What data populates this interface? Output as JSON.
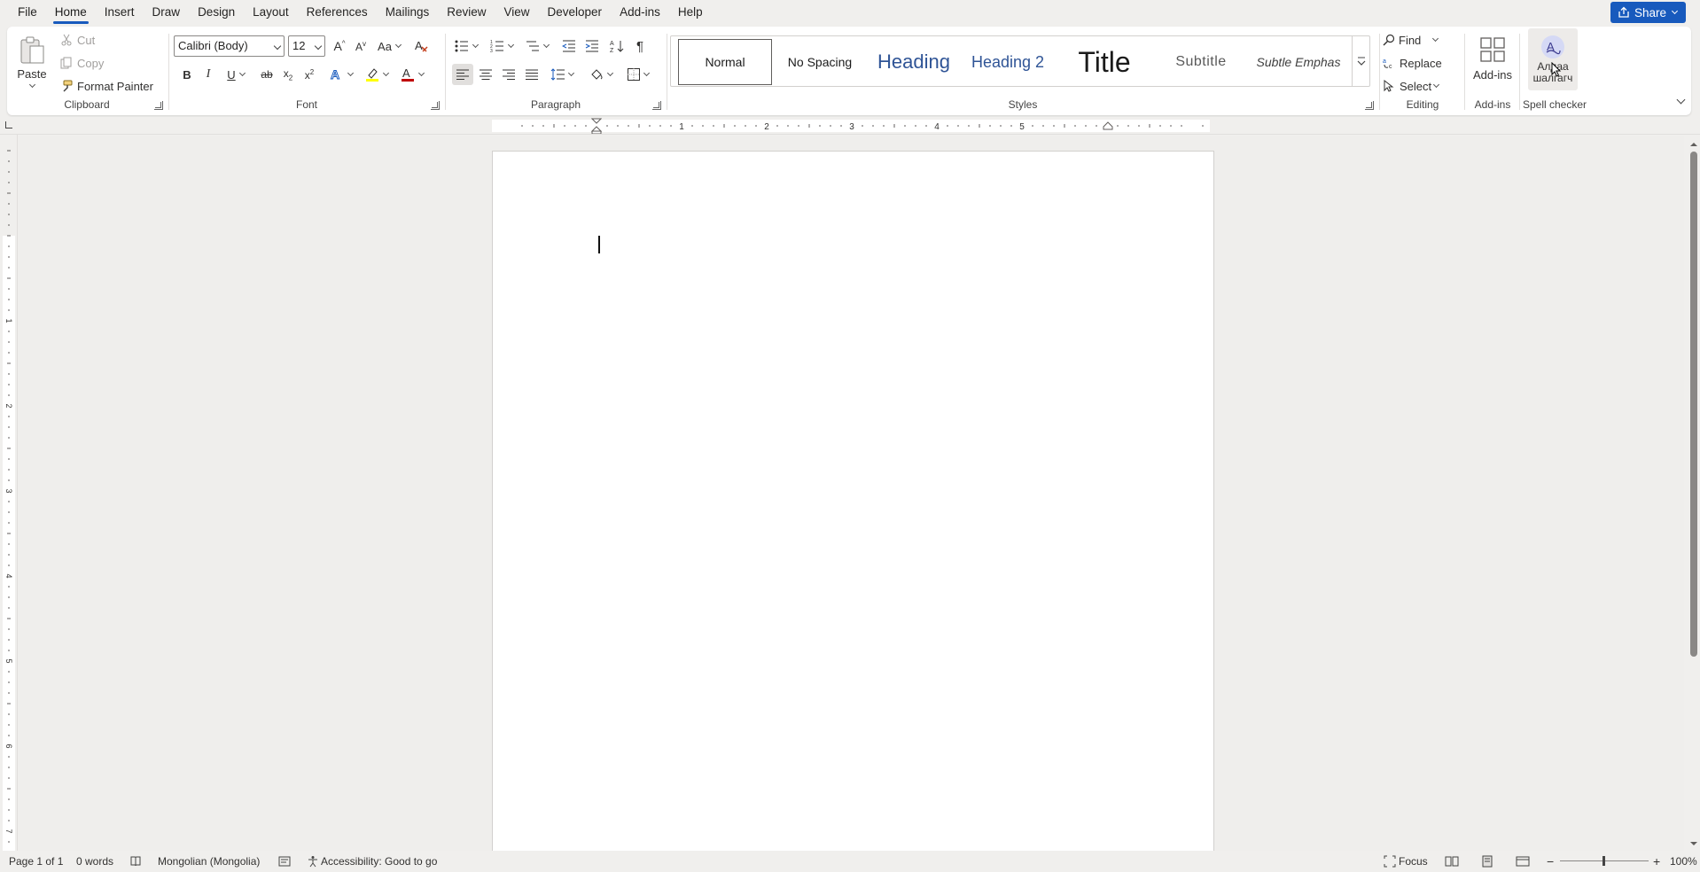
{
  "menu": {
    "items": [
      "File",
      "Home",
      "Insert",
      "Draw",
      "Design",
      "Layout",
      "References",
      "Mailings",
      "Review",
      "View",
      "Developer",
      "Add-ins",
      "Help"
    ],
    "active": "Home",
    "share_label": "Share"
  },
  "clipboard": {
    "paste_label": "Paste",
    "cut_label": "Cut",
    "copy_label": "Copy",
    "format_painter_label": "Format Painter",
    "group_label": "Clipboard"
  },
  "font": {
    "family": "Calibri (Body)",
    "size": "12",
    "group_label": "Font"
  },
  "paragraph": {
    "group_label": "Paragraph"
  },
  "styles": {
    "items": [
      "Normal",
      "No Spacing",
      "Heading",
      "Heading 2",
      "Title",
      "Subtitle",
      "Subtle Emphas"
    ],
    "selected": "Normal",
    "group_label": "Styles"
  },
  "editing": {
    "find_label": "Find",
    "replace_label": "Replace",
    "select_label": "Select",
    "group_label": "Editing"
  },
  "addins": {
    "button_label": "Add-ins",
    "group_label": "Add-ins"
  },
  "spell": {
    "button_line1": "Алдаа",
    "button_line2": "шалгагч",
    "group_label": "Spell checker"
  },
  "ruler": {
    "numbers": [
      "1",
      "2",
      "3",
      "4",
      "5"
    ],
    "vnumbers": [
      "1",
      "2",
      "3",
      "4",
      "5",
      "6",
      "7"
    ]
  },
  "status": {
    "page": "Page 1 of 1",
    "words": "0 words",
    "language": "Mongolian (Mongolia)",
    "accessibility": "Accessibility: Good to go",
    "focus": "Focus",
    "zoom": "100%"
  },
  "colors": {
    "accent": "#185abd",
    "highlight": "#ffff00",
    "font_color": "#c00000"
  }
}
